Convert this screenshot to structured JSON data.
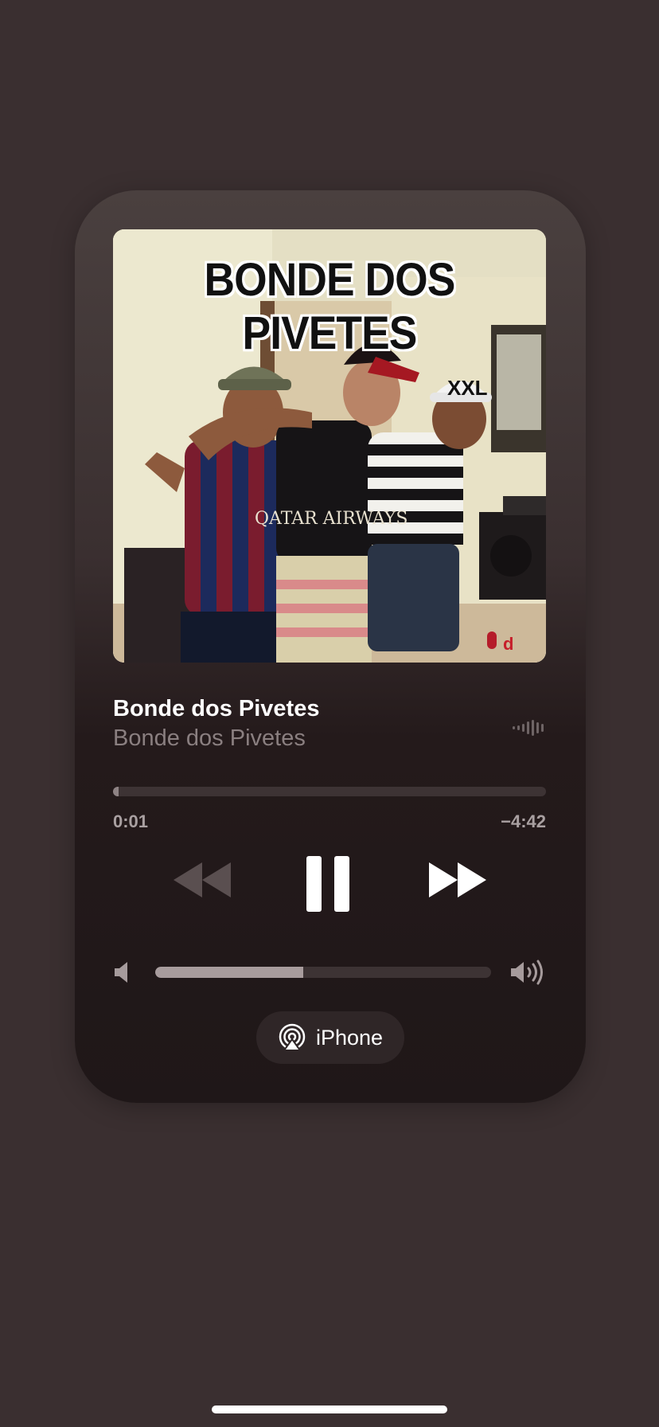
{
  "album_art": {
    "title_text": "BONDE DOS PIVETES",
    "jersey_text": "QATAR AIRWAYS",
    "cap_text": "XXL"
  },
  "now_playing": {
    "title": "Bonde dos Pivetes",
    "artist": "Bonde dos Pivetes",
    "audio_indicator_icon": "waveform-icon"
  },
  "playback": {
    "elapsed": "0:01",
    "remaining": "−4:42",
    "progress_fraction": 0.004
  },
  "controls": {
    "rewind_icon": "rewind-icon",
    "pause_icon": "pause-icon",
    "forward_icon": "fast-forward-icon"
  },
  "volume": {
    "level_fraction": 0.44
  },
  "output": {
    "device_label": "iPhone",
    "icon": "airplay-audio-icon"
  },
  "colors": {
    "background": "#3a2f30",
    "card_top": "#4a403f",
    "card_bottom": "#1f1718",
    "artist_text": "#8a7f80",
    "track_fill": "#8e8384"
  }
}
